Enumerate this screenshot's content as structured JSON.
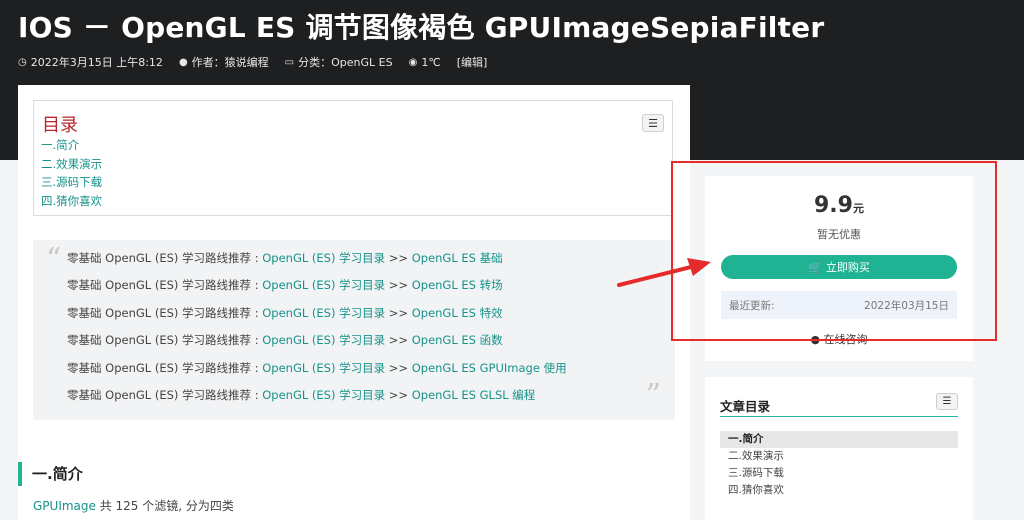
{
  "header": {
    "title": "IOS － OpenGL ES 调节图像褐色 GPUImageSepiaFilter",
    "meta": {
      "date_icon": "clock-icon",
      "date": "2022年3月15日 上午8:12",
      "author_icon": "user-icon",
      "author": "作者：猿说编程",
      "category_icon": "folder-icon",
      "category": "分类：OpenGL ES",
      "views_icon": "eye-icon",
      "views": "1℃",
      "edit": "[编辑]"
    }
  },
  "toc": {
    "title": "目录",
    "toggle_icon": "list-toggle-icon",
    "items": [
      "一.简介",
      "二.效果演示",
      "三.源码下载",
      "四.猜你喜欢"
    ]
  },
  "quote": {
    "prefix": "零基础 OpenGL (ES) 学习路线推荐 : ",
    "link_main": "OpenGL (ES) 学习目录",
    "sep": " >> ",
    "lines": [
      "OpenGL ES 基础",
      "OpenGL ES 转场",
      "OpenGL ES 特效",
      "OpenGL ES 函数",
      "OpenGL ES GPUImage 使用",
      "OpenGL ES GLSL 编程"
    ]
  },
  "section": {
    "heading": "一.简介",
    "para_link": "GPUImage",
    "para_rest": " 共 125 个滤镜, 分为四类"
  },
  "buy": {
    "price": "9.9",
    "unit": "元",
    "discount": "暂无优惠",
    "button_icon": "cart-icon",
    "button": "立即购买",
    "update_label": "最近更新:",
    "update_date": "2022年03月15日",
    "consult_icon": "chat-icon",
    "consult": "在线咨询"
  },
  "sidebar_toc": {
    "title": "文章目录",
    "items": [
      "一.简介",
      "二.效果演示",
      "三.源码下载",
      "四.猜你喜欢"
    ],
    "active_index": 0
  },
  "annotation": {
    "highlight_color": "#e52b2b"
  },
  "colors": {
    "accent": "#1fb393",
    "link": "#16928a",
    "toc_title": "#b7262a",
    "hero_bg": "#1e1f21"
  }
}
